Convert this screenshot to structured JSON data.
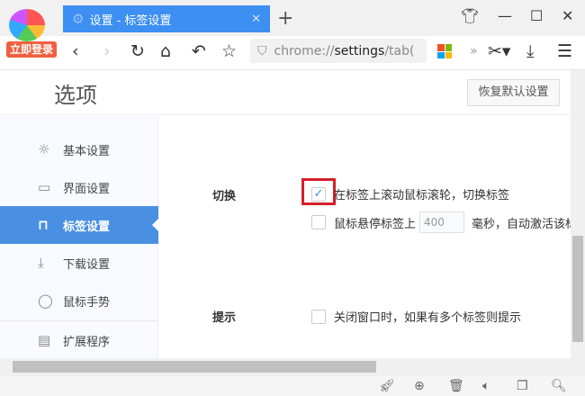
{
  "browser": {
    "login_label": "立即登录",
    "tab_title": "设置 - 标签设置",
    "url_prefix": "chrome://",
    "url_host": "settings",
    "url_path": "/tab(",
    "more_label": "»"
  },
  "header": {
    "title": "选项",
    "reset_button": "恢复默认设置"
  },
  "sidebar": {
    "items": [
      {
        "label": "基本设置",
        "icon": "sun-icon"
      },
      {
        "label": "界面设置",
        "icon": "window-icon"
      },
      {
        "label": "标签设置",
        "icon": "tab-icon",
        "active": true
      },
      {
        "label": "下载设置",
        "icon": "download-icon"
      },
      {
        "label": "鼠标手势",
        "icon": "mouse-icon"
      },
      {
        "label": "扩展程序",
        "icon": "extension-icon"
      }
    ]
  },
  "sections": {
    "switch": {
      "title": "切换",
      "opt1": "在标签上滚动鼠标滚轮，切换标签",
      "opt1_checked": true,
      "opt2_pre": "鼠标悬停标签上",
      "opt2_value": "400",
      "opt2_post": "毫秒，自动激活该标签",
      "opt2_checked": false
    },
    "hint": {
      "title": "提示",
      "opt1": "关闭窗口时，如果有多个标签则提示",
      "opt1_checked": false
    }
  },
  "colors": {
    "accent": "#4a90e2",
    "tab": "#3d8ff2",
    "highlight": "#d4202a"
  }
}
